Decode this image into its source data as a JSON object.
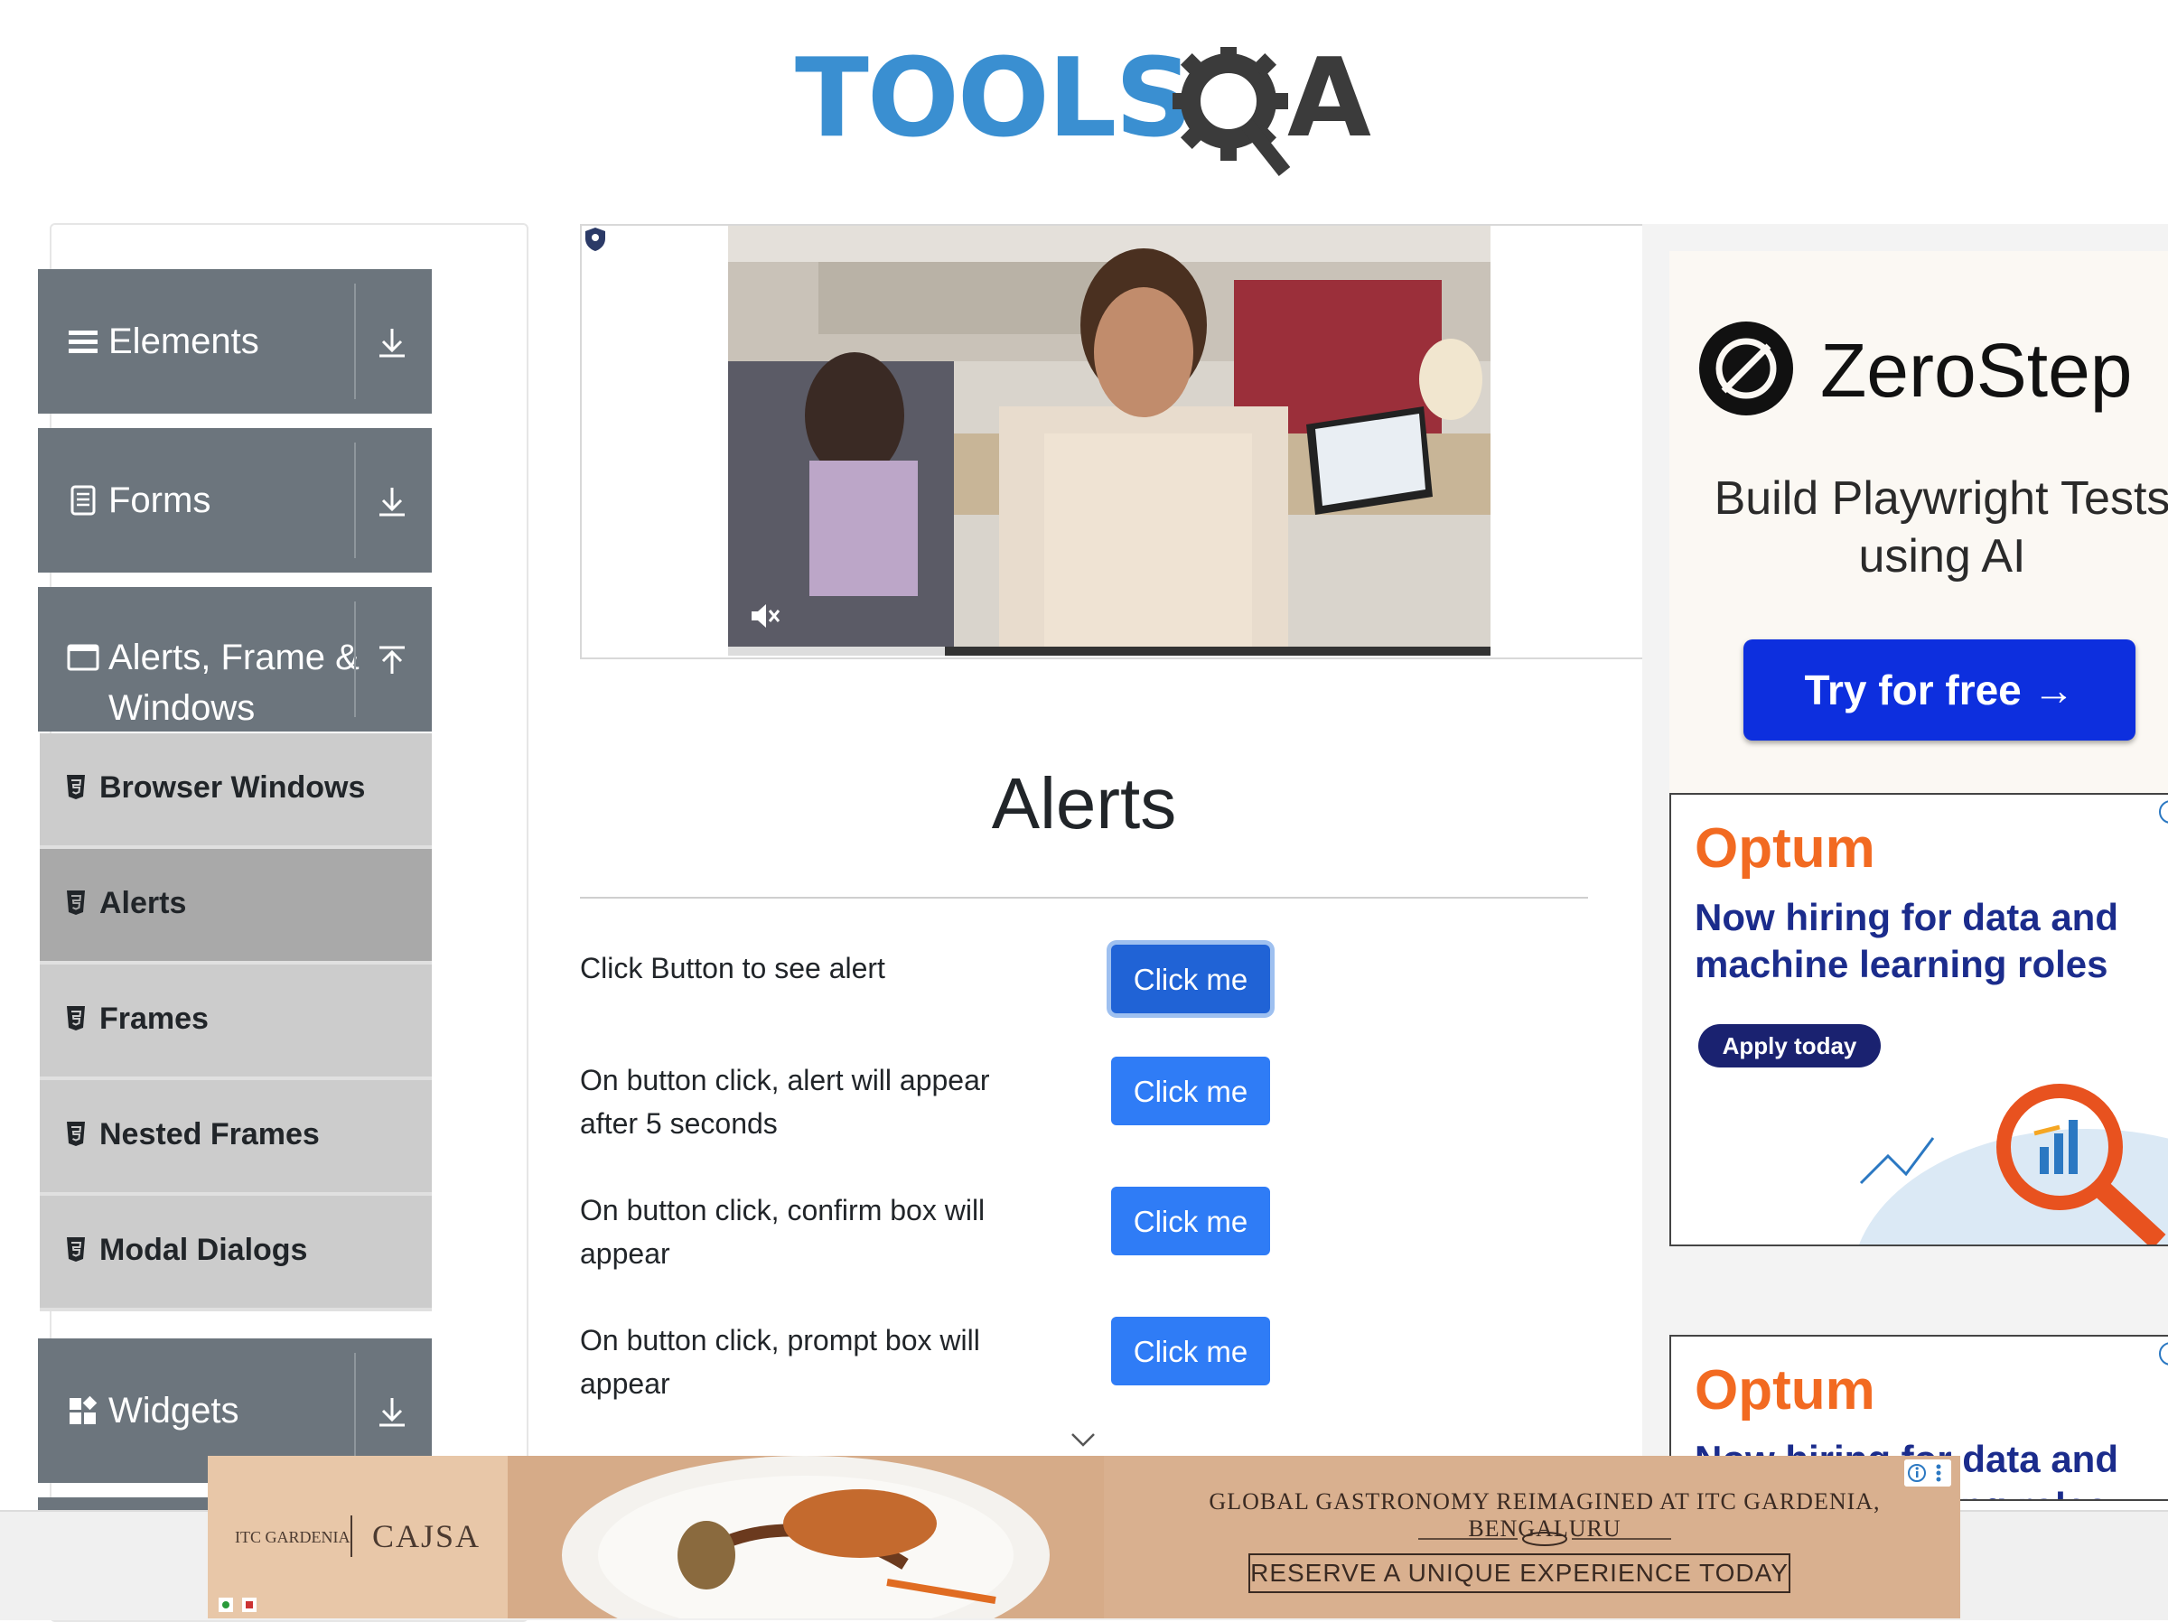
{
  "header": {
    "logo_text": "TOOLS",
    "logo_suffix": "A"
  },
  "sidebar": {
    "groups": [
      {
        "label": "Elements"
      },
      {
        "label": "Forms"
      },
      {
        "label": "Alerts, Frame &",
        "label_line2": "Windows"
      },
      {
        "label": "Widgets"
      }
    ],
    "alerts_items": [
      {
        "label": "Browser Windows",
        "active": false
      },
      {
        "label": "Alerts",
        "active": true
      },
      {
        "label": "Frames",
        "active": false
      },
      {
        "label": "Nested Frames",
        "active": false
      },
      {
        "label": "Modal Dialogs",
        "active": false
      }
    ]
  },
  "main": {
    "title": "Alerts",
    "rows": [
      {
        "label": "Click Button to see alert",
        "button": "Click me"
      },
      {
        "label": "On button click, alert will appear after 5 seconds",
        "button": "Click me"
      },
      {
        "label": "On button click, confirm box will appear",
        "button": "Click me"
      },
      {
        "label": "On button click, prompt box will appear",
        "button": "Click me"
      }
    ]
  },
  "ads": {
    "zerostep": {
      "brand": "ZeroStep",
      "tagline": "Build Playwright Tests using AI",
      "cta": "Try for free →"
    },
    "optum1": {
      "brand": "Optum",
      "headline": "Now hiring for data and machine learning roles",
      "cta": "Apply today"
    },
    "optum2": {
      "brand": "Optum",
      "headline": "Now hiring for data and machine learning roles"
    },
    "bottom": {
      "brand_left": "ITC GARDENIA",
      "brand_right": "CAJSA",
      "headline": "GLOBAL GASTRONOMY REIMAGINED AT ITC GARDENIA, BENGALURU",
      "cta": "RESERVE A UNIQUE EXPERIENCE TODAY"
    }
  },
  "colors": {
    "sidebar_group": "#6c757d",
    "sidebar_item": "#cccccc",
    "sidebar_item_active": "#a9a9a9",
    "primary_button": "#2f7cf6",
    "logo_blue": "#3a8fd1",
    "optum_orange": "#f26a21",
    "zerostep_blue": "#0d2fde"
  },
  "icons": {
    "elements": "hamburger-icon",
    "forms": "document-icon",
    "alerts": "window-icon",
    "widgets": "widgets-icon",
    "expand": "download-arrow-icon",
    "collapse": "upload-arrow-icon",
    "sub_item": "html5-icon",
    "video_mute": "muted-speaker-icon"
  }
}
